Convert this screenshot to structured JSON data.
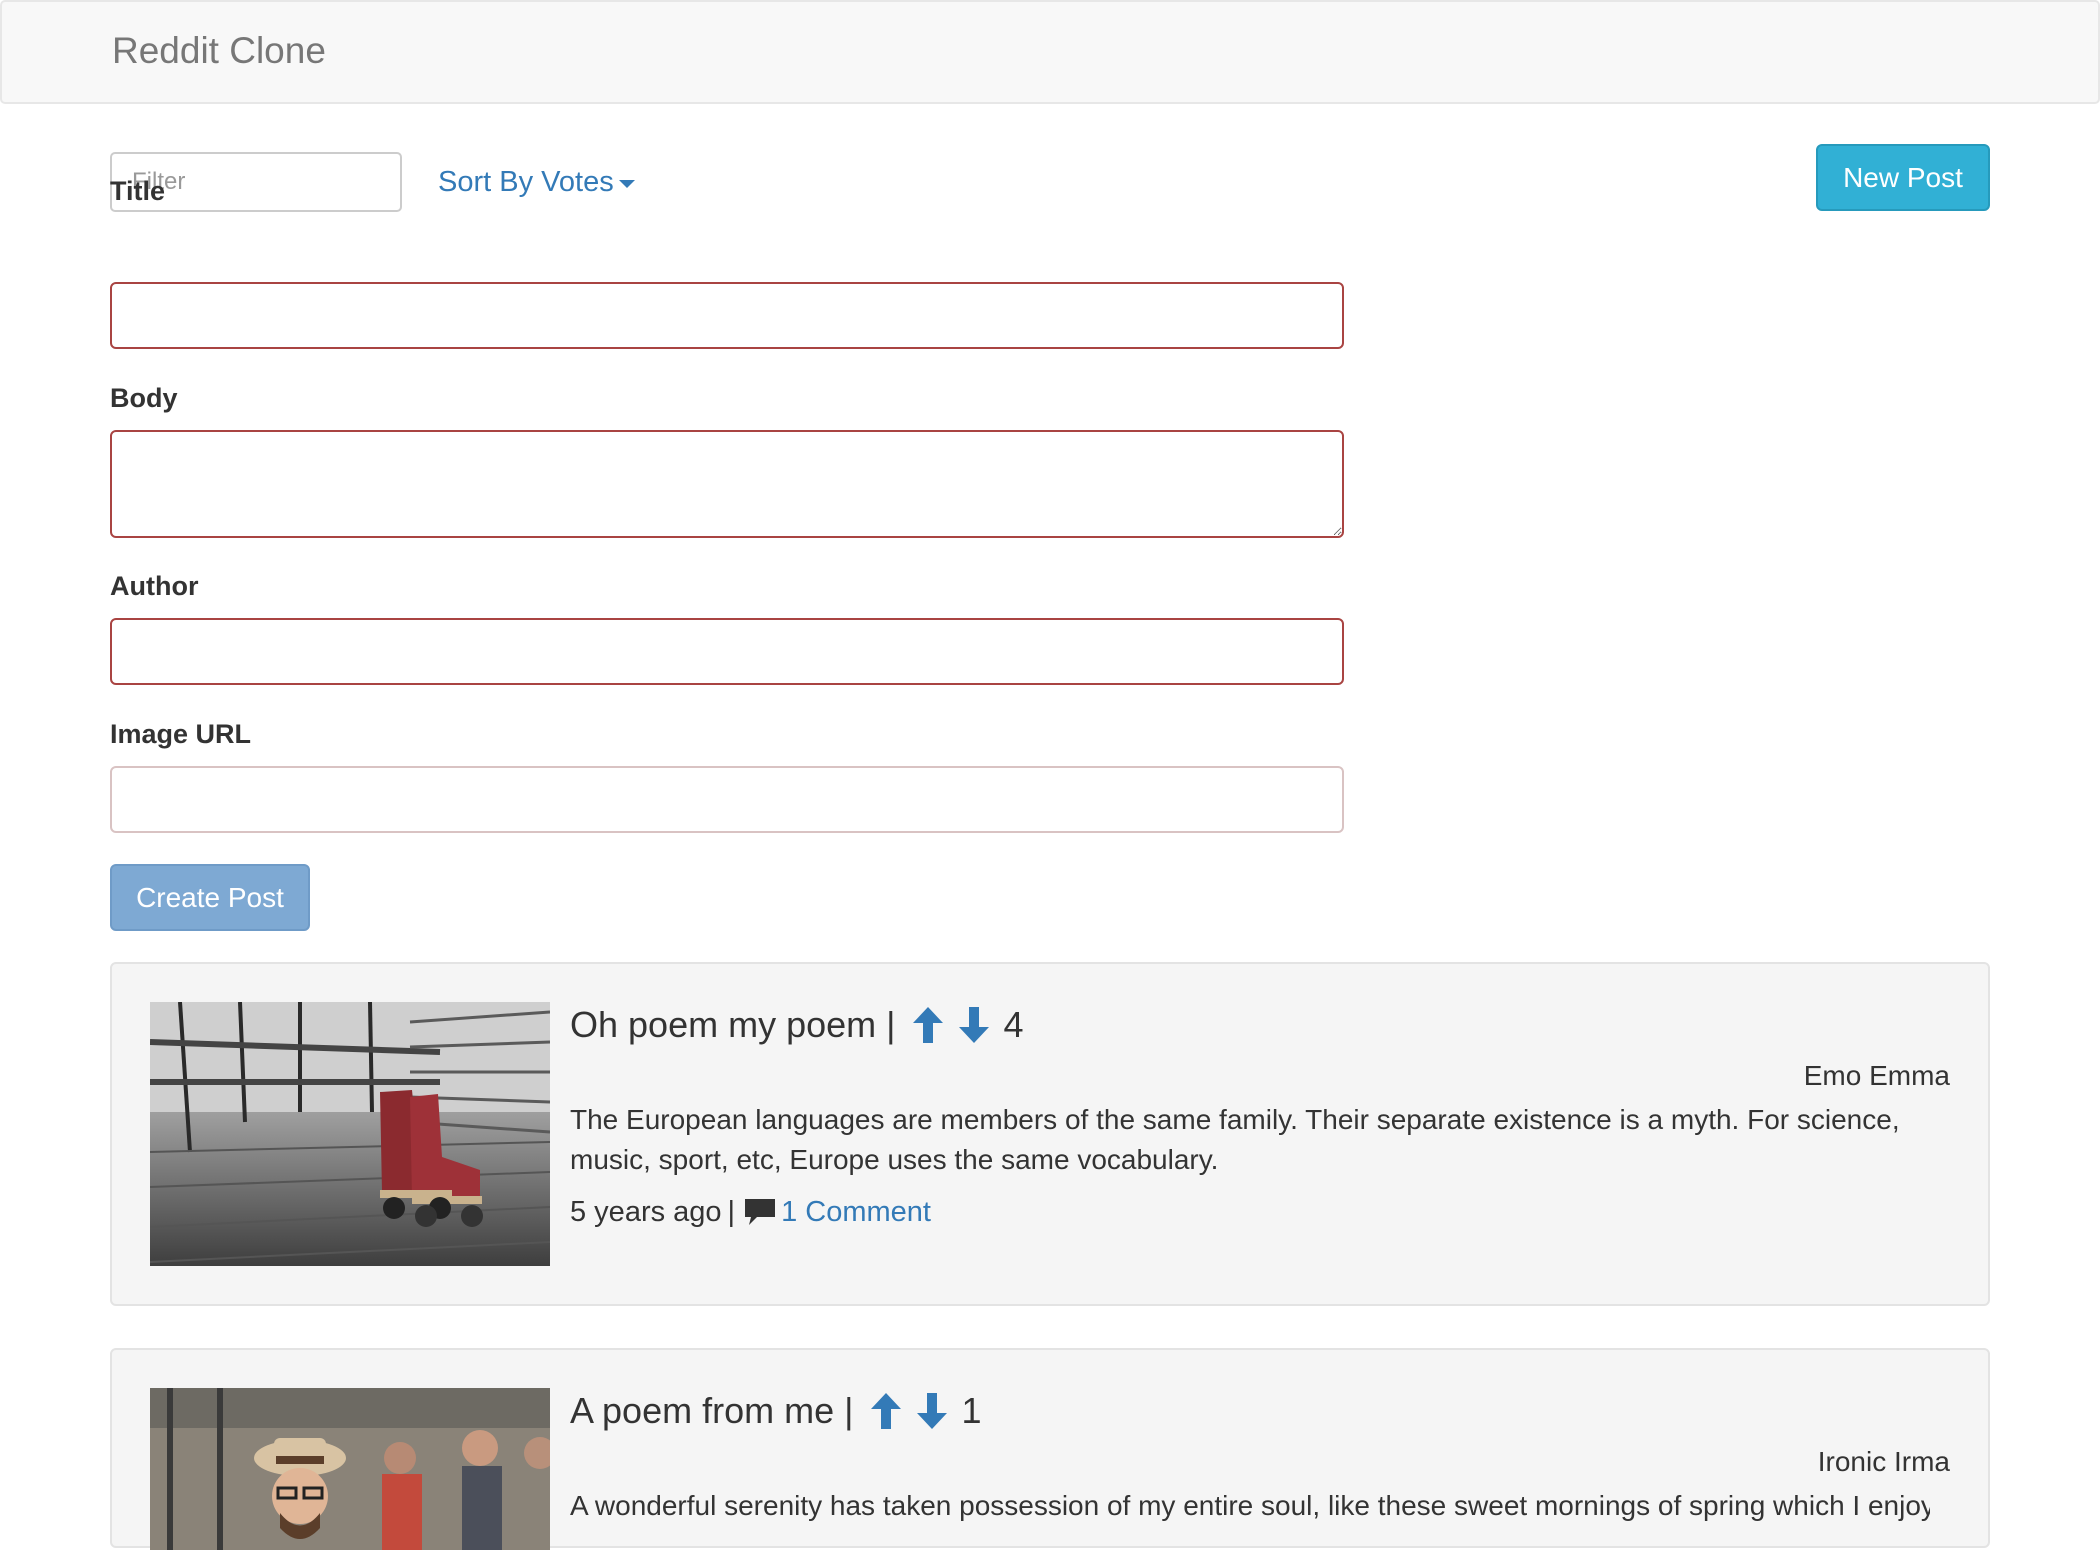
{
  "navbar": {
    "brand": "Reddit Clone"
  },
  "toolbar": {
    "filter_placeholder": "Filter",
    "sort_label": "Sort By Votes",
    "new_post_label": "New Post"
  },
  "form": {
    "title_label": "Title",
    "title_value": "",
    "body_label": "Body",
    "body_value": "",
    "author_label": "Author",
    "author_value": "",
    "image_label": "Image URL",
    "image_value": "",
    "submit_label": "Create Post"
  },
  "posts": [
    {
      "title": "Oh poem my poem",
      "separator": "|",
      "votes": "4",
      "author": "Emo Emma",
      "body": "The European languages are members of the same family. Their separate existence is a myth. For science, music, sport, etc, Europe uses the same vocabulary.",
      "age": "5 years ago",
      "meta_separator": "|",
      "comments": "1 Comment"
    },
    {
      "title": "A poem from me",
      "separator": "|",
      "votes": "1",
      "author": "Ironic Irma",
      "body": "A wonderful serenity has taken possession of my entire soul, like these sweet mornings of spring which I enjoy"
    }
  ],
  "colors": {
    "link": "#337ab7",
    "info_button": "#31b0d5",
    "primary_disabled": "#7ea9d3",
    "error_border": "#a94442",
    "card_bg": "#f5f5f5"
  },
  "icons": {
    "upvote": "arrow-up-icon",
    "downvote": "arrow-down-icon",
    "comment": "comment-icon"
  }
}
